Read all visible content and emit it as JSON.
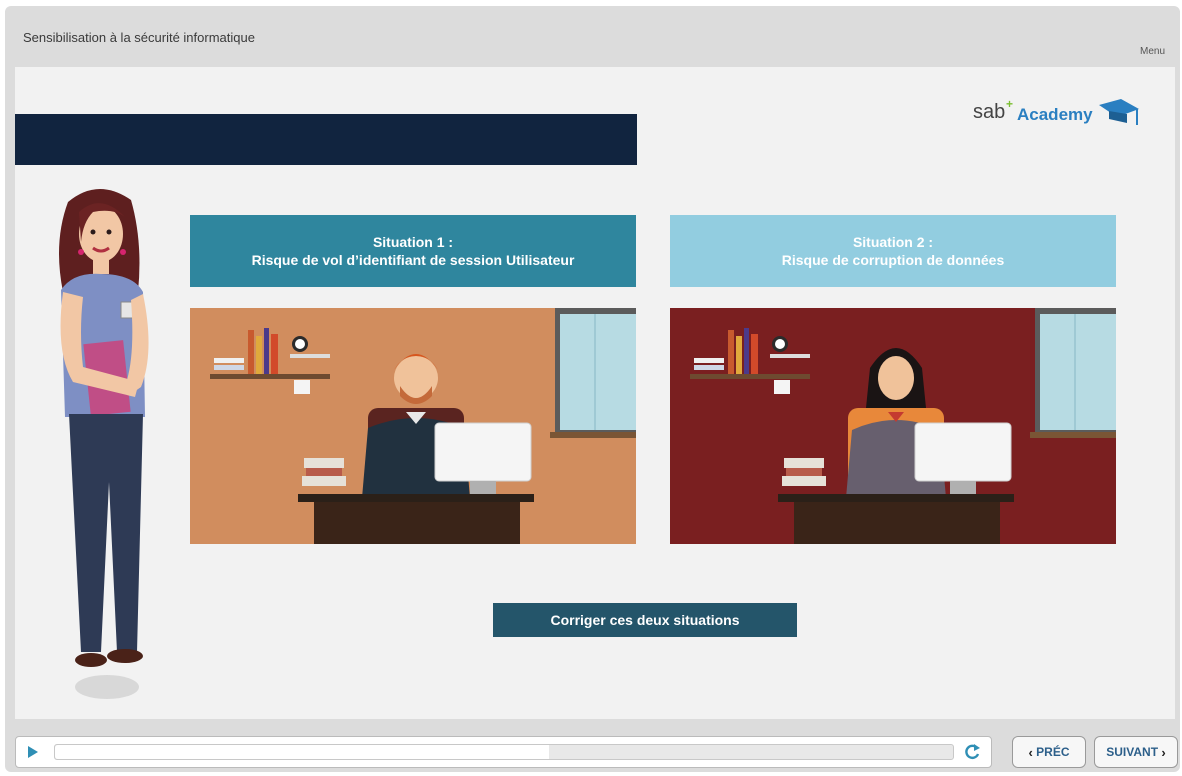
{
  "header": {
    "title": "Sensibilisation à la sécurité informatique",
    "menu_label": "Menu"
  },
  "logo": {
    "sab": "sab",
    "plus": "+",
    "academy": "Academy"
  },
  "situations": [
    {
      "title": "Situation 1 :",
      "subtitle": "Risque de vol d’identifiant de session Utilisateur"
    },
    {
      "title": "Situation 2 :",
      "subtitle": "Risque de corruption de données"
    }
  ],
  "main": {
    "fix_button_label": "Corriger ces deux situations"
  },
  "player": {
    "progress_fraction": 0.55
  },
  "nav": {
    "prev_label": "PRÉC",
    "next_label": "SUIVANT",
    "prev_chevron": "‹",
    "next_chevron": "›"
  },
  "colors": {
    "banner": "#11243f",
    "situation1": "#2f869e",
    "situation2": "#92cde0",
    "button": "#24556a",
    "scene1_wall": "#d18d5e",
    "scene2_wall": "#7a1f20"
  }
}
